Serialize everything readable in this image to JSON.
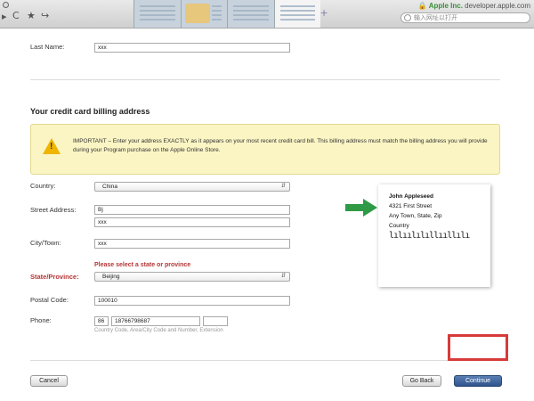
{
  "browser": {
    "nav_back": "▸",
    "nav_reload": "C",
    "nav_star": "★",
    "nav_share": "↪",
    "plus": "+",
    "site_org": "Apple Inc.",
    "site_domain": "developer.apple.com",
    "address_placeholder": "输入网址以打开"
  },
  "form": {
    "last_name": {
      "label": "Last Name:",
      "value": "xxx"
    },
    "section_title": "Your credit card billing address",
    "notice": "IMPORTANT – Enter your address EXACTLY as it appears on your most recent credit card bill. This billing address must match the billing address you will provide during your Program purchase on the Apple Online Store.",
    "country": {
      "label": "Country:",
      "value": "China"
    },
    "street": {
      "label": "Street Address:",
      "line1": "Bj",
      "line2": "xxx"
    },
    "city": {
      "label": "City/Town:",
      "value": "xxx"
    },
    "state": {
      "label": "State/Province:",
      "error": "Please select a state or province",
      "value": "Beijing"
    },
    "postal": {
      "label": "Postal Code:",
      "value": "100010"
    },
    "phone": {
      "label": "Phone:",
      "country_code": "86",
      "number": "18766798687",
      "extension": "",
      "hint": "Country Code, Area/City Code and Number, Extension"
    }
  },
  "sample_address": {
    "name": "John Appleseed",
    "line1": "4321 First Street",
    "line2": "Any Town, State, Zip",
    "line3": "Country",
    "barcode": "lılıılılıllııllılı"
  },
  "buttons": {
    "cancel": "Cancel",
    "go_back": "Go Back",
    "continue": "Continue"
  },
  "colors": {
    "highlight": "#d83a3a",
    "error": "#b53535",
    "primary_button": "#2f548d",
    "notice_bg": "#fbf5c4"
  }
}
